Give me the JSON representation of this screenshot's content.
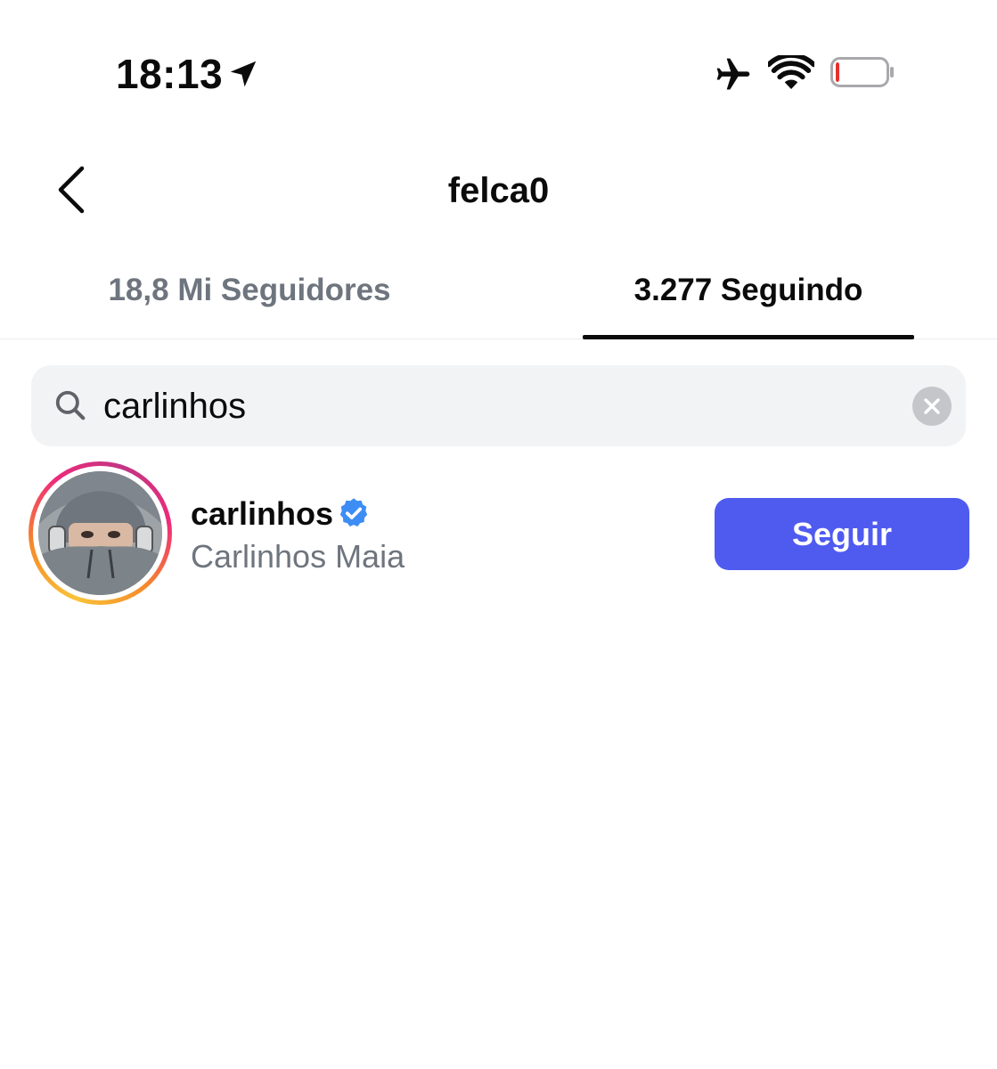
{
  "status_bar": {
    "time": "18:13",
    "icons": [
      "location-arrow-icon",
      "airplane-icon",
      "wifi-icon",
      "battery-icon"
    ],
    "battery_level": 0.08,
    "battery_color": "#e5322d"
  },
  "header": {
    "title": "felca0",
    "back_icon": "chevron-left-icon"
  },
  "tabs": [
    {
      "label": "18,8 Mi Seguidores",
      "active": false
    },
    {
      "label": "3.277 Seguindo",
      "active": true
    }
  ],
  "search": {
    "value": "carlinhos",
    "icon": "search-icon",
    "clear_icon": "close-icon"
  },
  "results": [
    {
      "username": "carlinhos",
      "verified": true,
      "full_name": "Carlinhos Maia",
      "button_label": "Seguir",
      "has_story_ring": true
    }
  ],
  "colors": {
    "accent": "#4f5bef",
    "verified": "#3d8df5",
    "secondary_text": "#6e757e",
    "search_bg": "#f2f3f5"
  }
}
